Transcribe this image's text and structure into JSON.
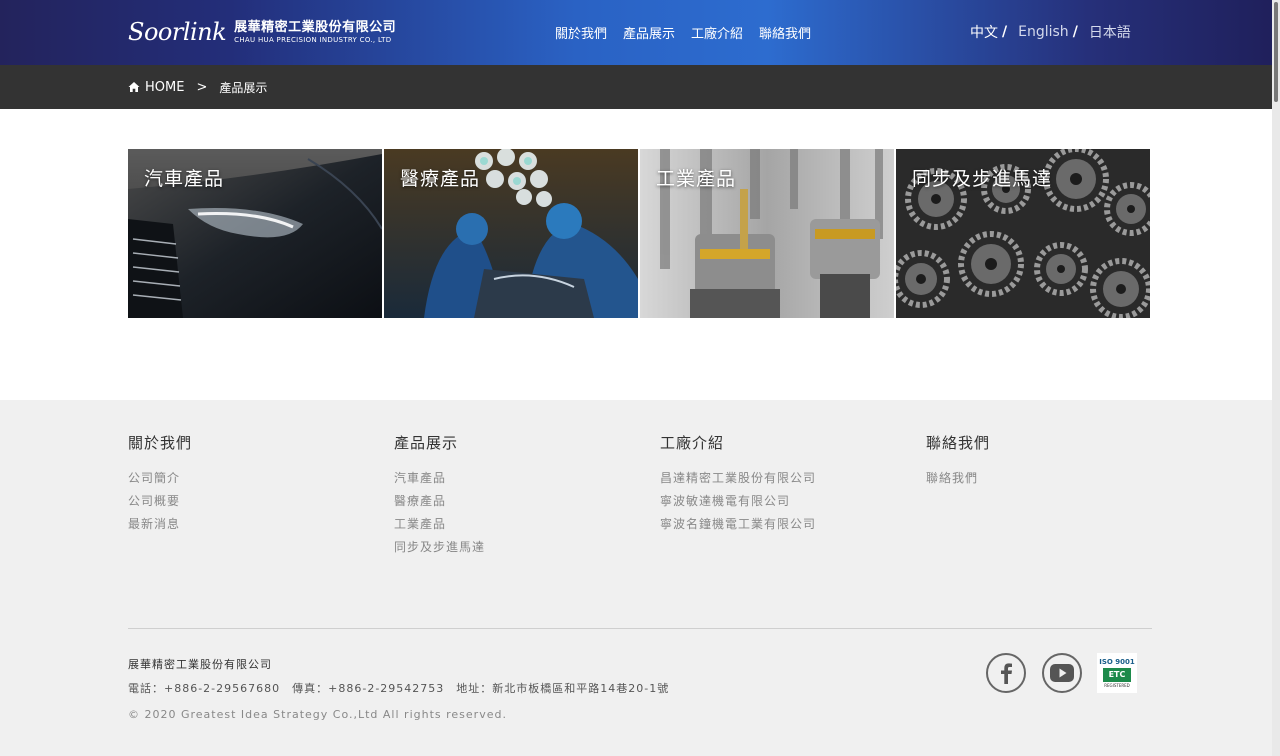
{
  "header": {
    "logo_mark": "Soorlink",
    "logo_cn": "展華精密工業股份有限公司",
    "logo_en": "CHAU HUA PRECISION INDUSTRY CO., LTD",
    "nav": [
      "關於我們",
      "產品展示",
      "工廠介紹",
      "聯絡我們"
    ],
    "languages": [
      "中文",
      "English",
      "日本語"
    ],
    "lang_separator": "/"
  },
  "breadcrumb": {
    "home": "HOME",
    "separator": ">",
    "current": "產品展示"
  },
  "products": [
    {
      "label": "汽車產品",
      "icon": "car-headlight-image"
    },
    {
      "label": "醫療產品",
      "icon": "surgery-room-image"
    },
    {
      "label": "工業產品",
      "icon": "cutting-tools-image"
    },
    {
      "label": "同步及步進馬達",
      "icon": "gears-image"
    }
  ],
  "footer": {
    "columns": [
      {
        "title": "關於我們",
        "links": [
          "公司簡介",
          "公司概要",
          "最新消息"
        ]
      },
      {
        "title": "產品展示",
        "links": [
          "汽車產品",
          "醫療產品",
          "工業產品",
          "同步及步進馬達"
        ]
      },
      {
        "title": "工廠介紹",
        "links": [
          "昌達精密工業股份有限公司",
          "寧波敏達機電有限公司",
          "寧波名鐘機電工業有限公司"
        ]
      },
      {
        "title": "聯絡我們",
        "links": [
          "聯絡我們"
        ]
      }
    ],
    "company": "展華精密工業股份有限公司",
    "phone": "電話：+886-2-29567680",
    "fax": "傳真：+886-2-29542753",
    "address": "地址：新北市板橋區和平路14巷20-1號",
    "copyright": "© 2020 Greatest Idea Strategy Co.,Ltd All rights reserved.",
    "social": [
      "facebook-icon",
      "youtube-icon"
    ],
    "iso": {
      "top": "ISO 9001",
      "mark": "ETC",
      "bottom": "REGISTERED"
    }
  }
}
